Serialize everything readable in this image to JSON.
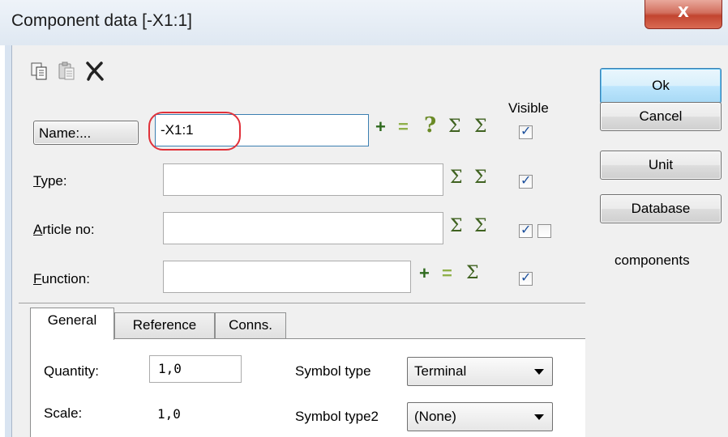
{
  "window": {
    "title": "Component data [-X1:1]",
    "close_glyph": "X"
  },
  "toolbar": {
    "icons": [
      "copy-icon",
      "paste-icon",
      "delete-icon"
    ]
  },
  "fields": {
    "visible_label": "Visible",
    "name_button": "Name:...",
    "name_value": "-X1:1",
    "type_label_prefix": "T",
    "type_label_rest": "ype:",
    "type_value": "",
    "article_label_prefix": "A",
    "article_label_rest": "rticle no:",
    "article_value": "",
    "function_label_prefix": "F",
    "function_label_rest": "unction:",
    "function_value": ""
  },
  "symbols": {
    "plus": "+",
    "equals": "=",
    "question": "?",
    "sigma": "Σ"
  },
  "tabs": [
    {
      "label": "General",
      "active": true
    },
    {
      "label": "Reference",
      "active": false
    },
    {
      "label": "Conns.",
      "active": false
    }
  ],
  "general": {
    "quantity_label": "Quantity:",
    "quantity_value": "1,0",
    "scale_label": "Scale:",
    "scale_value": "1,0",
    "symbol_type_label": "Symbol type",
    "symbol_type_value": "Terminal",
    "symbol_type2_label": "Symbol type2",
    "symbol_type2_value": "(None)"
  },
  "buttons": {
    "ok": "Ok",
    "cancel": "Cancel",
    "unit": "Unit",
    "database": "Database",
    "components": "components"
  },
  "colors": {
    "highlight": "#e0313a",
    "sum_green": "#3f6220",
    "check_blue": "#1b4f9c"
  }
}
